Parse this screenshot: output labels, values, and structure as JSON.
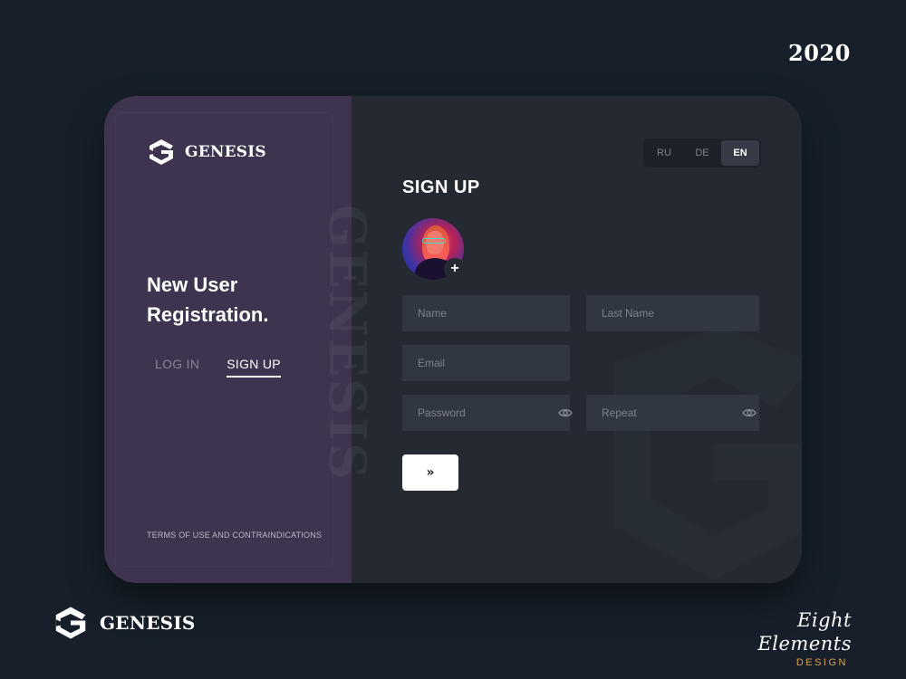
{
  "year": "2020",
  "brand": {
    "name": "GENESIS"
  },
  "left_panel": {
    "headline_line1": "New User",
    "headline_line2": "Registration.",
    "tabs": [
      {
        "label": "LOG IN",
        "active": false
      },
      {
        "label": "SIGN UP",
        "active": true
      }
    ],
    "terms_link": "TERMS OF USE AND CONTRAINDICATIONS",
    "watermark": "GENESIS"
  },
  "form": {
    "title": "SIGN UP",
    "languages": [
      {
        "label": "RU",
        "active": false
      },
      {
        "label": "DE",
        "active": false
      },
      {
        "label": "EN",
        "active": true
      }
    ],
    "avatar_add_label": "+",
    "fields": {
      "name": {
        "placeholder": "Name",
        "value": ""
      },
      "last_name": {
        "placeholder": "Last Name",
        "value": ""
      },
      "email": {
        "placeholder": "Email",
        "value": ""
      },
      "password": {
        "placeholder": "Password",
        "value": ""
      },
      "repeat": {
        "placeholder": "Repeat",
        "value": ""
      }
    },
    "submit_label": "»",
    "icons": {
      "visibility_toggle": "eye-icon",
      "submit": "double-chevron-right-icon"
    }
  },
  "footer": {
    "brand_name": "GENESIS",
    "studio_script": "Eight Elements",
    "studio_sub": "DESIGN"
  },
  "colors": {
    "background": "#17202a",
    "left_panel": "#3e3450",
    "right_panel": "#252a32",
    "field": "#313741",
    "accent_gold": "#d9a34a"
  }
}
